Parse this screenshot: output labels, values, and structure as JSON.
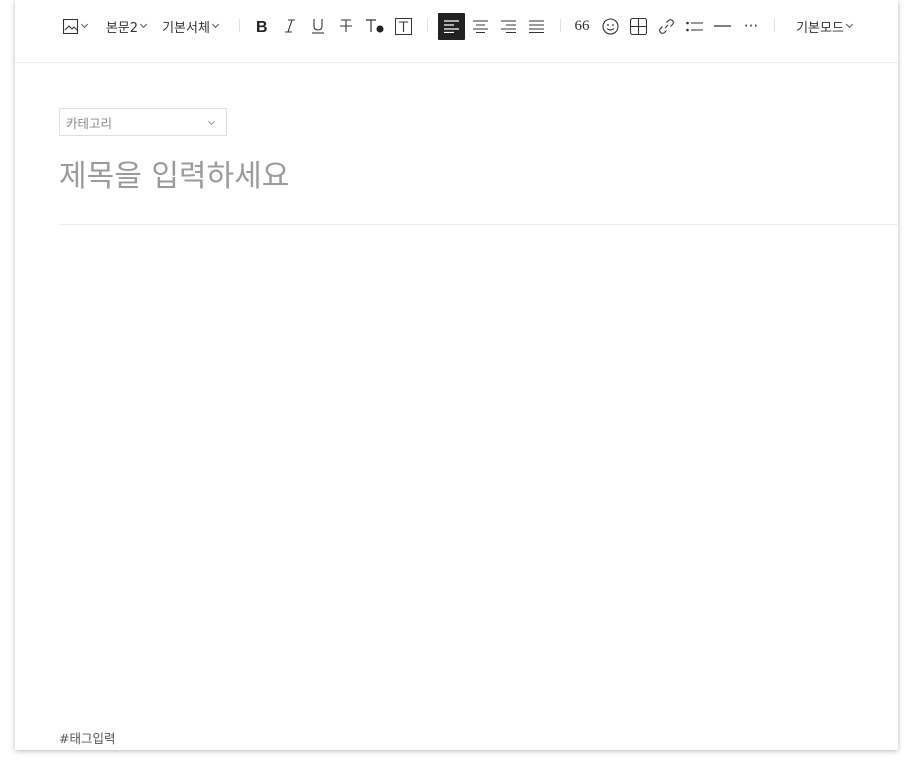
{
  "toolbar": {
    "image_icon": "image-icon",
    "paragraph_style": "본문2",
    "font_family": "기본서체",
    "bold_icon": "bold-icon",
    "italic_icon": "italic-icon",
    "underline_icon": "underline-icon",
    "strikethrough_icon": "strikethrough-icon",
    "text_color_icon": "text-color-icon",
    "text_background_icon": "text-background-icon",
    "align_left_icon": "align-left-icon",
    "align_center_icon": "align-center-icon",
    "align_right_icon": "align-right-icon",
    "align_justify_icon": "align-justify-icon",
    "quote_label": "66",
    "emoticon_icon": "emoticon-icon",
    "table_icon": "table-icon",
    "link_icon": "link-icon",
    "list_icon": "list-icon",
    "divider_icon": "horizontal-line-icon",
    "more_label": "···",
    "mode_label": "기본모드",
    "active_color": "#222222"
  },
  "category": {
    "placeholder": "카테고리"
  },
  "title": {
    "placeholder": "제목을 입력하세요",
    "value": ""
  },
  "tags": {
    "placeholder": "#태그입력",
    "value": ""
  }
}
